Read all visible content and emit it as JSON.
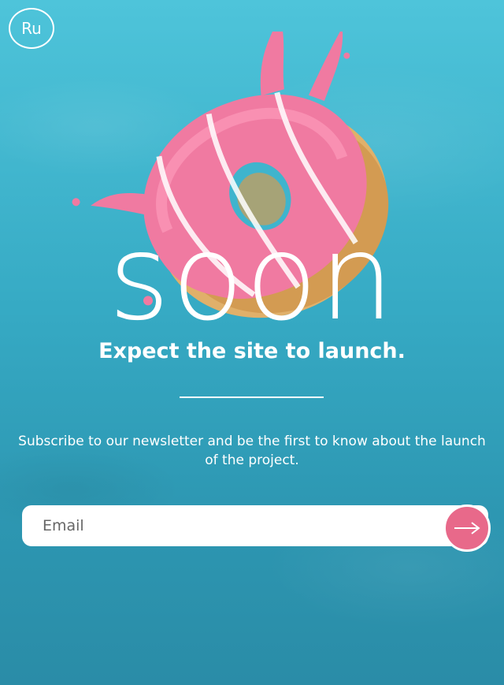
{
  "header": {
    "lang_label": "Ru"
  },
  "hero": {
    "headline": "soon",
    "tagline": "Expect the site to launch."
  },
  "newsletter": {
    "description": "Subscribe to our newsletter and be the first to know about the launch of the project.",
    "email_placeholder": "Email",
    "email_value": ""
  },
  "colors": {
    "background_top": "#4ec4da",
    "background_bottom": "#2a8ca7",
    "accent_pink": "#e8698a",
    "text": "#ffffff"
  },
  "icons": {
    "submit": "arrow-right-icon",
    "hero_image": "donut-illustration"
  }
}
